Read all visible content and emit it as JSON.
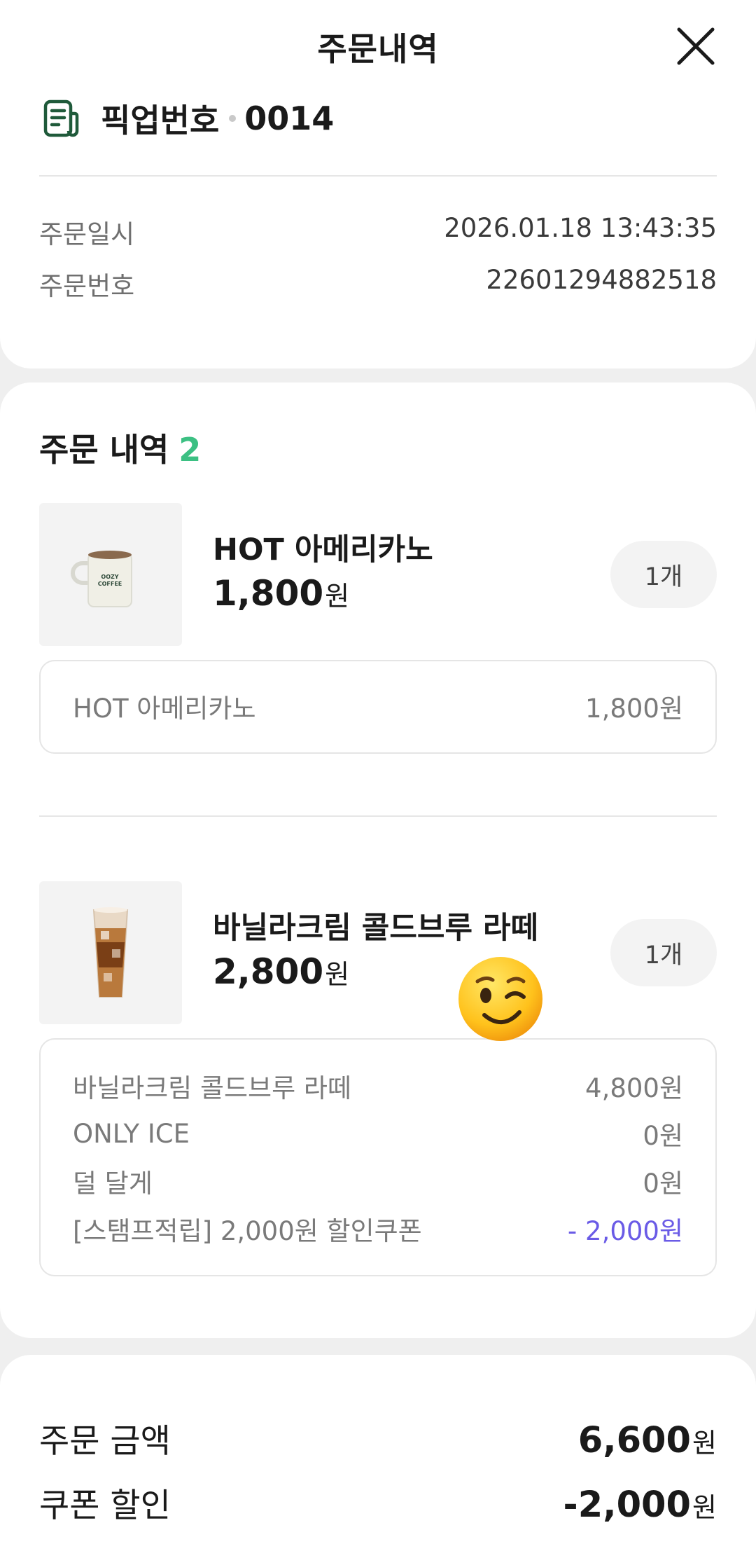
{
  "header": {
    "title": "주문내역"
  },
  "pickup": {
    "label": "픽업번호",
    "number": "0014"
  },
  "order_info": [
    {
      "label": "주문일시",
      "value": "2026.01.18 13:43:35"
    },
    {
      "label": "주문번호",
      "value": "22601294882518"
    }
  ],
  "order_list": {
    "title": "주문 내역",
    "count": "2",
    "items": [
      {
        "name": "HOT 아메리카노",
        "price": "1,800",
        "currency": "원",
        "qty": "1개",
        "thumb": "coffee-mug-image",
        "options": [
          {
            "name": "HOT 아메리카노",
            "price": "1,800원"
          }
        ]
      },
      {
        "name": "바닐라크림 콜드브루 라떼",
        "price": "2,800",
        "currency": "원",
        "qty": "1개",
        "thumb": "iced-latte-image",
        "options": [
          {
            "name": "바닐라크림 콜드브루 라떼",
            "price": "4,800원"
          },
          {
            "name": "ONLY ICE",
            "price": "0원"
          },
          {
            "name": "덜 달게",
            "price": "0원"
          },
          {
            "name": "[스탬프적립] 2,000원 할인쿠폰",
            "price": "- 2,000원"
          }
        ]
      }
    ]
  },
  "summary": {
    "order_amount_label": "주문 금액",
    "order_amount": "6,600",
    "coupon_label": "쿠폰 할인",
    "coupon_amount": "-2,000",
    "currency": "원"
  },
  "colors": {
    "accent_green": "#3cc083",
    "discount_purple": "#6a5be6",
    "pickup_icon_green": "#1f5a3a"
  },
  "overlay": {
    "icon": "winking-face-emoji"
  }
}
